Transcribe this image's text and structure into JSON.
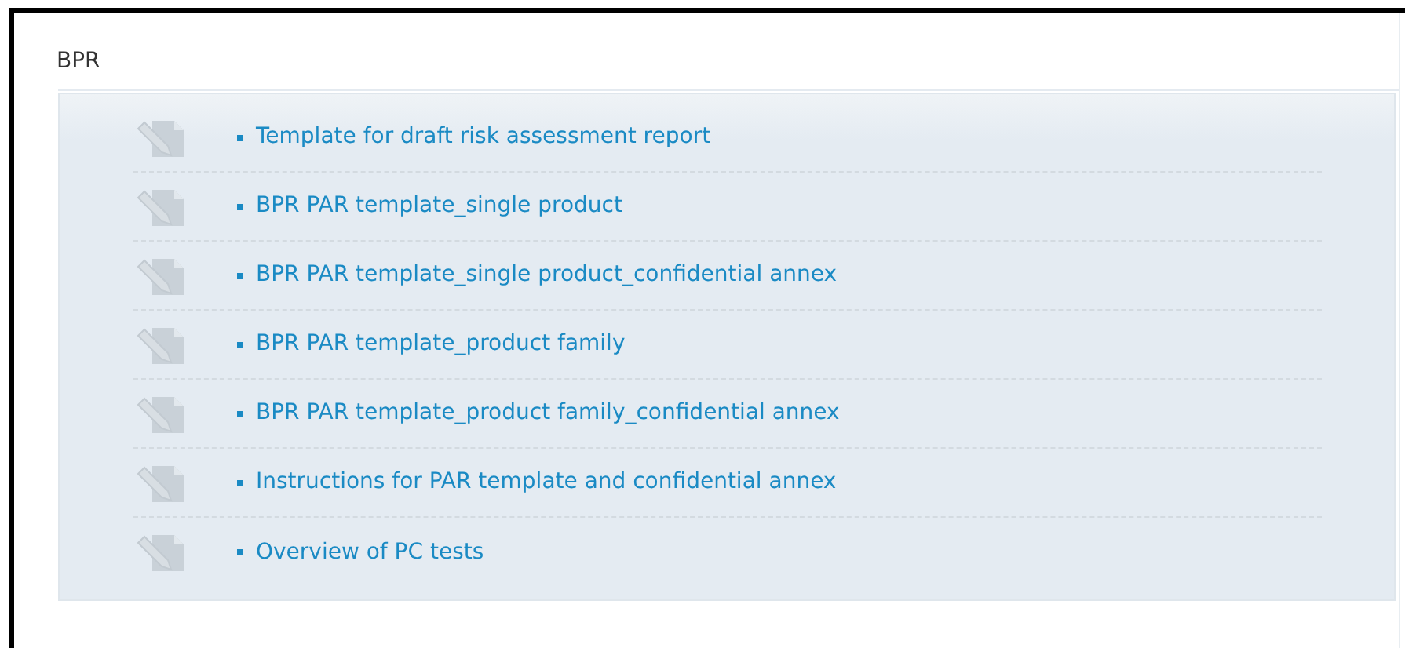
{
  "section": {
    "title": "BPR"
  },
  "documents": [
    {
      "label": "Template for draft risk assessment report"
    },
    {
      "label": "BPR PAR template_single product"
    },
    {
      "label": "BPR PAR template_single product_confidential annex"
    },
    {
      "label": "BPR PAR template_product family"
    },
    {
      "label": "BPR PAR template_product family_confidential annex"
    },
    {
      "label": "Instructions for PAR template and confidential annex"
    },
    {
      "label": "Overview of PC tests"
    }
  ]
}
